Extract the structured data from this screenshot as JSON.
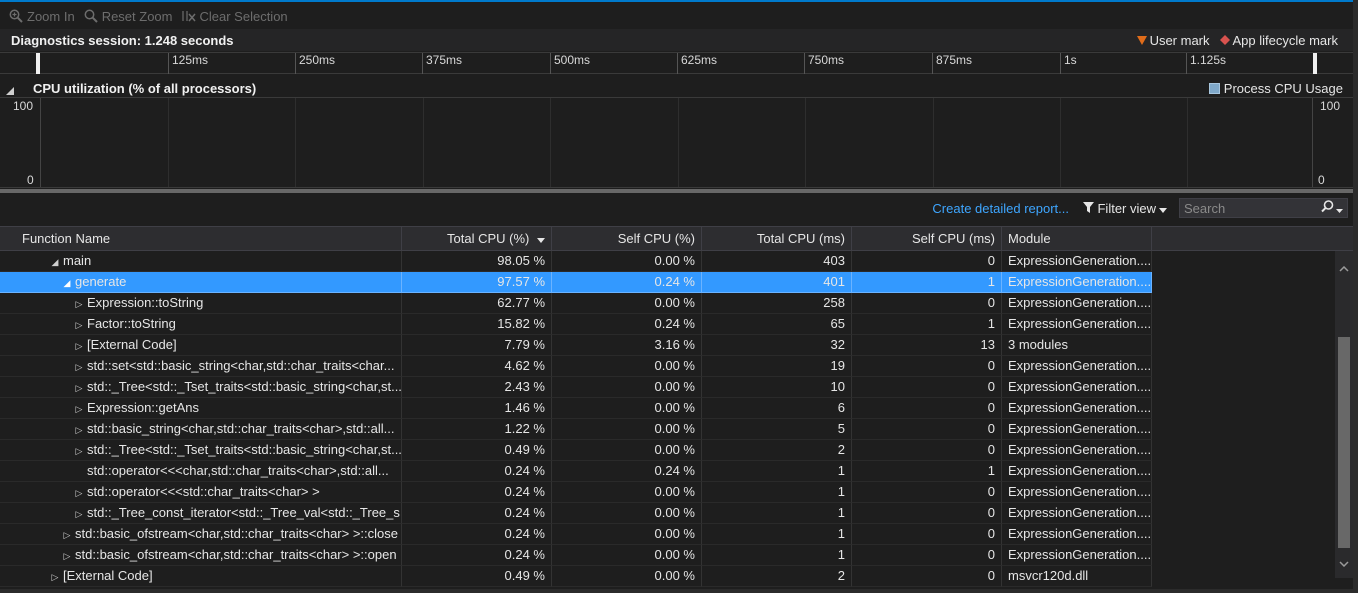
{
  "toolbar": {
    "zoom_in": "Zoom In",
    "reset_zoom": "Reset Zoom",
    "clear_selection": "Clear Selection"
  },
  "session": {
    "title": "Diagnostics session: 1.248 seconds",
    "user_mark": "User mark",
    "app_lifecycle_mark": "App lifecycle mark",
    "user_mark_color": "#e06c1a",
    "app_lifecycle_color": "#d9534f"
  },
  "ruler": {
    "ticks": [
      "125ms",
      "250ms",
      "375ms",
      "500ms",
      "625ms",
      "750ms",
      "875ms",
      "1s",
      "1.125s"
    ]
  },
  "cpu": {
    "title": "CPU utilization (% of all processors)",
    "legend": "Process CPU Usage",
    "legend_color": "#7fa8c9",
    "y_max": "100",
    "y_min": "0"
  },
  "actions": {
    "create_report": "Create detailed report...",
    "filter_view": "Filter view",
    "search_placeholder": "Search"
  },
  "table": {
    "columns": [
      "Function Name",
      "Total CPU (%)",
      "Self CPU (%)",
      "Total CPU (ms)",
      "Self CPU (ms)",
      "Module"
    ],
    "rows": [
      {
        "name": "main",
        "total_pct": "98.05 %",
        "self_pct": "0.00 %",
        "total_ms": "403",
        "self_ms": "0",
        "module": "ExpressionGeneration...."
      },
      {
        "name": "generate",
        "total_pct": "97.57 %",
        "self_pct": "0.24 %",
        "total_ms": "401",
        "self_ms": "1",
        "module": "ExpressionGeneration...."
      },
      {
        "name": "Expression::toString",
        "total_pct": "62.77 %",
        "self_pct": "0.00 %",
        "total_ms": "258",
        "self_ms": "0",
        "module": "ExpressionGeneration...."
      },
      {
        "name": "Factor::toString",
        "total_pct": "15.82 %",
        "self_pct": "0.24 %",
        "total_ms": "65",
        "self_ms": "1",
        "module": "ExpressionGeneration...."
      },
      {
        "name": "[External Code]",
        "total_pct": "7.79 %",
        "self_pct": "3.16 %",
        "total_ms": "32",
        "self_ms": "13",
        "module": "3 modules"
      },
      {
        "name": "std::set<std::basic_string<char,std::char_traits<char...",
        "total_pct": "4.62 %",
        "self_pct": "0.00 %",
        "total_ms": "19",
        "self_ms": "0",
        "module": "ExpressionGeneration...."
      },
      {
        "name": "std::_Tree<std::_Tset_traits<std::basic_string<char,st...",
        "total_pct": "2.43 %",
        "self_pct": "0.00 %",
        "total_ms": "10",
        "self_ms": "0",
        "module": "ExpressionGeneration...."
      },
      {
        "name": "Expression::getAns",
        "total_pct": "1.46 %",
        "self_pct": "0.00 %",
        "total_ms": "6",
        "self_ms": "0",
        "module": "ExpressionGeneration...."
      },
      {
        "name": "std::basic_string<char,std::char_traits<char>,std::all...",
        "total_pct": "1.22 %",
        "self_pct": "0.00 %",
        "total_ms": "5",
        "self_ms": "0",
        "module": "ExpressionGeneration...."
      },
      {
        "name": "std::_Tree<std::_Tset_traits<std::basic_string<char,st...",
        "total_pct": "0.49 %",
        "self_pct": "0.00 %",
        "total_ms": "2",
        "self_ms": "0",
        "module": "ExpressionGeneration...."
      },
      {
        "name": "std::operator<<<char,std::char_traits<char>,std::all...",
        "total_pct": "0.24 %",
        "self_pct": "0.24 %",
        "total_ms": "1",
        "self_ms": "1",
        "module": "ExpressionGeneration...."
      },
      {
        "name": "std::operator<<<std::char_traits<char> >",
        "total_pct": "0.24 %",
        "self_pct": "0.00 %",
        "total_ms": "1",
        "self_ms": "0",
        "module": "ExpressionGeneration...."
      },
      {
        "name": "std::_Tree_const_iterator<std::_Tree_val<std::_Tree_s...",
        "total_pct": "0.24 %",
        "self_pct": "0.00 %",
        "total_ms": "1",
        "self_ms": "0",
        "module": "ExpressionGeneration...."
      },
      {
        "name": "std::basic_ofstream<char,std::char_traits<char> >::close",
        "total_pct": "0.24 %",
        "self_pct": "0.00 %",
        "total_ms": "1",
        "self_ms": "0",
        "module": "ExpressionGeneration...."
      },
      {
        "name": "std::basic_ofstream<char,std::char_traits<char> >::open",
        "total_pct": "0.24 %",
        "self_pct": "0.00 %",
        "total_ms": "1",
        "self_ms": "0",
        "module": "ExpressionGeneration...."
      },
      {
        "name": "[External Code]",
        "total_pct": "0.49 %",
        "self_pct": "0.00 %",
        "total_ms": "2",
        "self_ms": "0",
        "module": "msvcr120d.dll"
      }
    ]
  }
}
